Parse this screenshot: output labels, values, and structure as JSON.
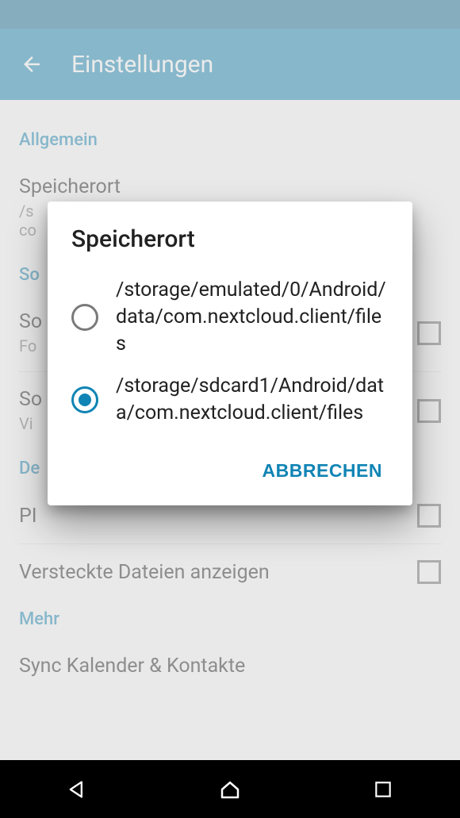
{
  "appbar": {
    "title": "Einstellungen"
  },
  "sections": {
    "general": {
      "header": "Allgemein",
      "storage_title": "Speicherort",
      "storage_sub_line1": "/s",
      "storage_sub_line2": "co"
    },
    "s_header_fragment": "So",
    "item2_title_fragment": "So",
    "item2_sub_fragment": "Fo",
    "item3_title_fragment": "So",
    "item3_sub_fragment": "Vi",
    "d_header_fragment": "De",
    "item4_title_fragment": "PI",
    "hidden_files": "Versteckte Dateien anzeigen",
    "more_header": "Mehr",
    "sync_fragment": "Sync Kalender & Kontakte"
  },
  "dialog": {
    "title": "Speicherort",
    "options": [
      {
        "label": "/storage/emulated/0/Android/data/com.nextcloud.client/files",
        "selected": false
      },
      {
        "label": "/storage/sdcard1/Android/data/com.nextcloud.client/files",
        "selected": true
      }
    ],
    "cancel": "ABBRECHEN"
  }
}
